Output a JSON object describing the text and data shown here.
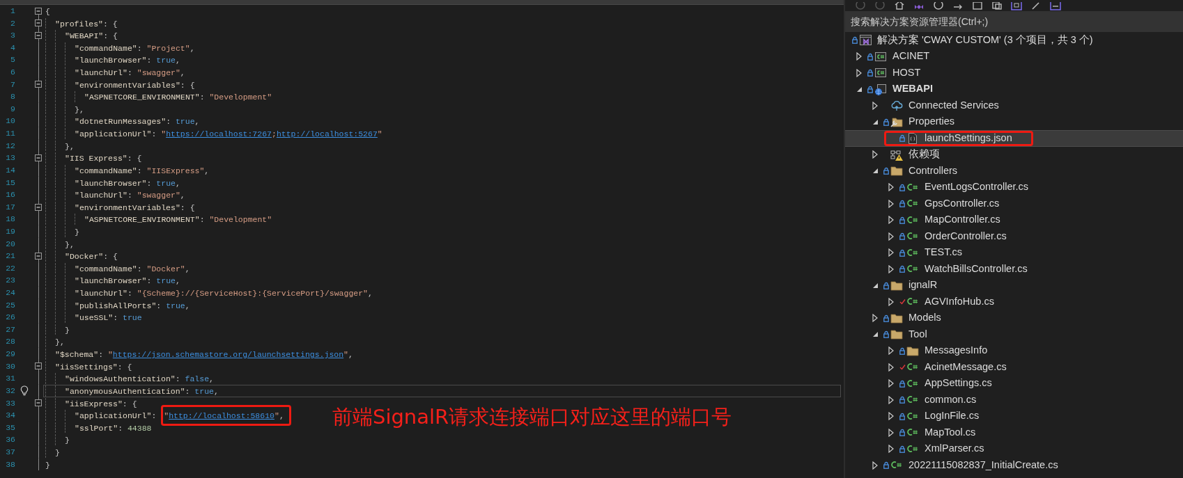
{
  "editor": {
    "lines": [
      {
        "number": "1",
        "current": false,
        "tokens": [
          {
            "kind": "punct",
            "text": "{"
          }
        ],
        "children": [
          {
            "number": "2",
            "current": false,
            "tokens": [
              {
                "kind": "key",
                "text": "\"profiles\""
              },
              {
                "kind": "punct",
                "text": ": {"
              }
            ],
            "children": [
              {
                "number": "3",
                "current": false,
                "tokens": [
                  {
                    "kind": "key",
                    "text": "\"WEBAPI\""
                  },
                  {
                    "kind": "punct",
                    "text": ": {"
                  }
                ],
                "children": [
                  {
                    "number": "4",
                    "current": false,
                    "tokens": [
                      {
                        "kind": "key",
                        "text": "\"commandName\""
                      },
                      {
                        "kind": "punct",
                        "text": ": "
                      },
                      {
                        "kind": "str",
                        "text": "\"Project\""
                      },
                      {
                        "kind": "punct",
                        "text": ","
                      }
                    ]
                  },
                  {
                    "number": "5",
                    "current": false,
                    "tokens": [
                      {
                        "kind": "key",
                        "text": "\"launchBrowser\""
                      },
                      {
                        "kind": "punct",
                        "text": ": "
                      },
                      {
                        "kind": "kw",
                        "text": "true"
                      },
                      {
                        "kind": "punct",
                        "text": ","
                      }
                    ]
                  },
                  {
                    "number": "6",
                    "current": false,
                    "tokens": [
                      {
                        "kind": "key",
                        "text": "\"launchUrl\""
                      },
                      {
                        "kind": "punct",
                        "text": ": "
                      },
                      {
                        "kind": "str",
                        "text": "\"swagger\""
                      },
                      {
                        "kind": "punct",
                        "text": ","
                      }
                    ]
                  },
                  {
                    "number": "7",
                    "current": false,
                    "tokens": [
                      {
                        "kind": "key",
                        "text": "\"environmentVariables\""
                      },
                      {
                        "kind": "punct",
                        "text": ": {"
                      }
                    ],
                    "children": [
                      {
                        "number": "8",
                        "current": false,
                        "tokens": [
                          {
                            "kind": "key",
                            "text": "\"ASPNETCORE_ENVIRONMENT\""
                          },
                          {
                            "kind": "punct",
                            "text": ": "
                          },
                          {
                            "kind": "str",
                            "text": "\"Development\""
                          }
                        ]
                      }
                    ]
                  },
                  {
                    "number": "9",
                    "current": false,
                    "tokens": [
                      {
                        "kind": "punct",
                        "text": "},"
                      }
                    ]
                  },
                  {
                    "number": "10",
                    "current": false,
                    "tokens": [
                      {
                        "kind": "key",
                        "text": "\"dotnetRunMessages\""
                      },
                      {
                        "kind": "punct",
                        "text": ": "
                      },
                      {
                        "kind": "kw",
                        "text": "true"
                      },
                      {
                        "kind": "punct",
                        "text": ","
                      }
                    ]
                  },
                  {
                    "number": "11",
                    "current": false,
                    "tokens": [
                      {
                        "kind": "key",
                        "text": "\"applicationUrl\""
                      },
                      {
                        "kind": "punct",
                        "text": ": "
                      },
                      {
                        "kind": "str",
                        "text": "\""
                      },
                      {
                        "kind": "link",
                        "text": "https://localhost:7267"
                      },
                      {
                        "kind": "str",
                        "text": ";"
                      },
                      {
                        "kind": "link",
                        "text": "http://localhost:5267"
                      },
                      {
                        "kind": "str",
                        "text": "\""
                      }
                    ]
                  }
                ]
              },
              {
                "number": "12",
                "current": false,
                "tokens": [
                  {
                    "kind": "punct",
                    "text": "},"
                  }
                ]
              },
              {
                "number": "13",
                "current": false,
                "tokens": [
                  {
                    "kind": "key",
                    "text": "\"IIS Express\""
                  },
                  {
                    "kind": "punct",
                    "text": ": {"
                  }
                ],
                "children": [
                  {
                    "number": "14",
                    "current": false,
                    "tokens": [
                      {
                        "kind": "key",
                        "text": "\"commandName\""
                      },
                      {
                        "kind": "punct",
                        "text": ": "
                      },
                      {
                        "kind": "str",
                        "text": "\"IISExpress\""
                      },
                      {
                        "kind": "punct",
                        "text": ","
                      }
                    ]
                  },
                  {
                    "number": "15",
                    "current": false,
                    "tokens": [
                      {
                        "kind": "key",
                        "text": "\"launchBrowser\""
                      },
                      {
                        "kind": "punct",
                        "text": ": "
                      },
                      {
                        "kind": "kw",
                        "text": "true"
                      },
                      {
                        "kind": "punct",
                        "text": ","
                      }
                    ]
                  },
                  {
                    "number": "16",
                    "current": false,
                    "tokens": [
                      {
                        "kind": "key",
                        "text": "\"launchUrl\""
                      },
                      {
                        "kind": "punct",
                        "text": ": "
                      },
                      {
                        "kind": "str",
                        "text": "\"swagger\""
                      },
                      {
                        "kind": "punct",
                        "text": ","
                      }
                    ]
                  },
                  {
                    "number": "17",
                    "current": false,
                    "tokens": [
                      {
                        "kind": "key",
                        "text": "\"environmentVariables\""
                      },
                      {
                        "kind": "punct",
                        "text": ": {"
                      }
                    ],
                    "children": [
                      {
                        "number": "18",
                        "current": false,
                        "tokens": [
                          {
                            "kind": "key",
                            "text": "\"ASPNETCORE_ENVIRONMENT\""
                          },
                          {
                            "kind": "punct",
                            "text": ": "
                          },
                          {
                            "kind": "str",
                            "text": "\"Development\""
                          }
                        ]
                      }
                    ]
                  },
                  {
                    "number": "19",
                    "current": false,
                    "tokens": [
                      {
                        "kind": "punct",
                        "text": "}"
                      }
                    ]
                  }
                ]
              },
              {
                "number": "20",
                "current": false,
                "tokens": [
                  {
                    "kind": "punct",
                    "text": "},"
                  }
                ]
              },
              {
                "number": "21",
                "current": false,
                "tokens": [
                  {
                    "kind": "key",
                    "text": "\"Docker\""
                  },
                  {
                    "kind": "punct",
                    "text": ": {"
                  }
                ],
                "children": [
                  {
                    "number": "22",
                    "current": false,
                    "tokens": [
                      {
                        "kind": "key",
                        "text": "\"commandName\""
                      },
                      {
                        "kind": "punct",
                        "text": ": "
                      },
                      {
                        "kind": "str",
                        "text": "\"Docker\""
                      },
                      {
                        "kind": "punct",
                        "text": ","
                      }
                    ]
                  },
                  {
                    "number": "23",
                    "current": false,
                    "tokens": [
                      {
                        "kind": "key",
                        "text": "\"launchBrowser\""
                      },
                      {
                        "kind": "punct",
                        "text": ": "
                      },
                      {
                        "kind": "kw",
                        "text": "true"
                      },
                      {
                        "kind": "punct",
                        "text": ","
                      }
                    ]
                  },
                  {
                    "number": "24",
                    "current": false,
                    "tokens": [
                      {
                        "kind": "key",
                        "text": "\"launchUrl\""
                      },
                      {
                        "kind": "punct",
                        "text": ": "
                      },
                      {
                        "kind": "str",
                        "text": "\"{Scheme}://{ServiceHost}:{ServicePort}/swagger\""
                      },
                      {
                        "kind": "punct",
                        "text": ","
                      }
                    ]
                  },
                  {
                    "number": "25",
                    "current": false,
                    "tokens": [
                      {
                        "kind": "key",
                        "text": "\"publishAllPorts\""
                      },
                      {
                        "kind": "punct",
                        "text": ": "
                      },
                      {
                        "kind": "kw",
                        "text": "true"
                      },
                      {
                        "kind": "punct",
                        "text": ","
                      }
                    ]
                  },
                  {
                    "number": "26",
                    "current": false,
                    "tokens": [
                      {
                        "kind": "key",
                        "text": "\"useSSL\""
                      },
                      {
                        "kind": "punct",
                        "text": ": "
                      },
                      {
                        "kind": "kw",
                        "text": "true"
                      }
                    ]
                  }
                ]
              },
              {
                "number": "27",
                "current": false,
                "tokens": [
                  {
                    "kind": "punct",
                    "text": "}"
                  }
                ]
              }
            ]
          },
          {
            "number": "28",
            "current": false,
            "tokens": [
              {
                "kind": "punct",
                "text": "},"
              }
            ]
          },
          {
            "number": "29",
            "current": false,
            "tokens": [
              {
                "kind": "key",
                "text": "\"$schema\""
              },
              {
                "kind": "punct",
                "text": ": "
              },
              {
                "kind": "str",
                "text": "\""
              },
              {
                "kind": "link",
                "text": "https://json.schemastore.org/launchsettings.json"
              },
              {
                "kind": "str",
                "text": "\""
              },
              {
                "kind": "punct",
                "text": ","
              }
            ]
          },
          {
            "number": "30",
            "current": false,
            "tokens": [
              {
                "kind": "key",
                "text": "\"iisSettings\""
              },
              {
                "kind": "punct",
                "text": ": {"
              }
            ],
            "children": [
              {
                "number": "31",
                "current": false,
                "tokens": [
                  {
                    "kind": "key",
                    "text": "\"windowsAuthentication\""
                  },
                  {
                    "kind": "punct",
                    "text": ": "
                  },
                  {
                    "kind": "kw",
                    "text": "false"
                  },
                  {
                    "kind": "punct",
                    "text": ","
                  }
                ]
              },
              {
                "number": "32",
                "current": true,
                "tokens": [
                  {
                    "kind": "key",
                    "text": "\"anonymousAuthentication\""
                  },
                  {
                    "kind": "punct",
                    "text": ": "
                  },
                  {
                    "kind": "kw",
                    "text": "true"
                  },
                  {
                    "kind": "punct",
                    "text": ","
                  }
                ]
              },
              {
                "number": "33",
                "current": false,
                "tokens": [
                  {
                    "kind": "key",
                    "text": "\"iisExpress\""
                  },
                  {
                    "kind": "punct",
                    "text": ": {"
                  }
                ],
                "children": [
                  {
                    "number": "34",
                    "current": false,
                    "tokens": [
                      {
                        "kind": "key",
                        "text": "\"applicationUrl\""
                      },
                      {
                        "kind": "punct",
                        "text": ": "
                      },
                      {
                        "kind": "callout",
                        "tokens": [
                          {
                            "kind": "str",
                            "text": "\""
                          },
                          {
                            "kind": "link",
                            "text": "http://localhost:58610"
                          },
                          {
                            "kind": "str",
                            "text": "\""
                          },
                          {
                            "kind": "punct",
                            "text": ","
                          }
                        ]
                      }
                    ]
                  },
                  {
                    "number": "35",
                    "current": false,
                    "tokens": [
                      {
                        "kind": "key",
                        "text": "\"sslPort\""
                      },
                      {
                        "kind": "punct",
                        "text": ": "
                      },
                      {
                        "kind": "num",
                        "text": "44388"
                      }
                    ]
                  }
                ]
              },
              {
                "number": "36",
                "current": false,
                "tokens": [
                  {
                    "kind": "punct",
                    "text": "}"
                  }
                ]
              }
            ]
          },
          {
            "number": "37",
            "current": false,
            "tokens": [
              {
                "kind": "punct",
                "text": "}"
              }
            ]
          }
        ]
      },
      {
        "number": "38",
        "current": false,
        "tokens": [
          {
            "kind": "punct",
            "text": "}"
          }
        ]
      }
    ],
    "annotation": "前端SignalR请求连接端口对应这里的端口号"
  },
  "solution_explorer": {
    "search": {
      "placeholder": "搜索解决方案资源管理器(Ctrl+;)"
    },
    "items": [
      {
        "label": "解决方案 'CWAY CUSTOM' (3 个项目，共 3 个)",
        "kind": "solution",
        "locked": true,
        "edited": false,
        "selected": false,
        "circled": false,
        "children": [
          {
            "label": "ACINET",
            "kind": "project",
            "locked": true,
            "edited": false,
            "expanded": false,
            "startup": false,
            "selected": false,
            "circled": false
          },
          {
            "label": "HOST",
            "kind": "project",
            "locked": true,
            "edited": false,
            "expanded": false,
            "startup": false,
            "selected": false,
            "circled": false
          },
          {
            "label": "WEBAPI",
            "kind": "webproject",
            "locked": true,
            "edited": false,
            "expanded": true,
            "startup": true,
            "selected": false,
            "circled": false,
            "children": [
              {
                "label": "Connected Services",
                "kind": "connected",
                "locked": false,
                "edited": false,
                "expanded": false,
                "selected": false,
                "circled": false
              },
              {
                "label": "Properties",
                "kind": "properties",
                "locked": true,
                "edited": false,
                "expanded": true,
                "selected": false,
                "circled": false,
                "children": [
                  {
                    "label": "launchSettings.json",
                    "kind": "json",
                    "locked": true,
                    "edited": false,
                    "selected": true,
                    "circled": true
                  }
                ]
              },
              {
                "label": "依赖项",
                "kind": "dependencies",
                "locked": false,
                "edited": false,
                "expanded": false,
                "selected": false,
                "circled": false
              },
              {
                "label": "Controllers",
                "kind": "folder",
                "locked": true,
                "edited": false,
                "expanded": true,
                "selected": false,
                "circled": false,
                "children": [
                  {
                    "label": "EventLogsController.cs",
                    "kind": "csharp",
                    "locked": true,
                    "edited": false,
                    "expanded": false,
                    "selected": false,
                    "circled": false
                  },
                  {
                    "label": "GpsController.cs",
                    "kind": "csharp",
                    "locked": true,
                    "edited": false,
                    "expanded": false,
                    "selected": false,
                    "circled": false
                  },
                  {
                    "label": "MapController.cs",
                    "kind": "csharp",
                    "locked": true,
                    "edited": false,
                    "expanded": false,
                    "selected": false,
                    "circled": false
                  },
                  {
                    "label": "OrderController.cs",
                    "kind": "csharp",
                    "locked": true,
                    "edited": false,
                    "expanded": false,
                    "selected": false,
                    "circled": false
                  },
                  {
                    "label": "TEST.cs",
                    "kind": "csharp",
                    "locked": true,
                    "edited": false,
                    "expanded": false,
                    "selected": false,
                    "circled": false
                  },
                  {
                    "label": "WatchBillsController.cs",
                    "kind": "csharp",
                    "locked": true,
                    "edited": false,
                    "expanded": false,
                    "selected": false,
                    "circled": false
                  }
                ]
              },
              {
                "label": "ignalR",
                "kind": "folder",
                "locked": true,
                "edited": false,
                "expanded": true,
                "selected": false,
                "circled": false,
                "children": [
                  {
                    "label": "AGVInfoHub.cs",
                    "kind": "csharp",
                    "locked": false,
                    "edited": true,
                    "expanded": false,
                    "selected": false,
                    "circled": false
                  }
                ]
              },
              {
                "label": "Models",
                "kind": "folder",
                "locked": true,
                "edited": false,
                "expanded": false,
                "selected": false,
                "circled": false
              },
              {
                "label": "Tool",
                "kind": "folder",
                "locked": true,
                "edited": false,
                "expanded": true,
                "selected": false,
                "circled": false,
                "children": [
                  {
                    "label": "MessagesInfo",
                    "kind": "folder",
                    "locked": true,
                    "edited": false,
                    "expanded": false,
                    "selected": false,
                    "circled": false
                  },
                  {
                    "label": "AcinetMessage.cs",
                    "kind": "csharp",
                    "locked": false,
                    "edited": true,
                    "expanded": false,
                    "selected": false,
                    "circled": false
                  },
                  {
                    "label": "AppSettings.cs",
                    "kind": "csharp",
                    "locked": true,
                    "edited": false,
                    "expanded": false,
                    "selected": false,
                    "circled": false
                  },
                  {
                    "label": "common.cs",
                    "kind": "csharp",
                    "locked": true,
                    "edited": false,
                    "expanded": false,
                    "selected": false,
                    "circled": false
                  },
                  {
                    "label": "LogInFile.cs",
                    "kind": "csharp",
                    "locked": true,
                    "edited": false,
                    "expanded": false,
                    "selected": false,
                    "circled": false
                  },
                  {
                    "label": "MapTool.cs",
                    "kind": "csharp",
                    "locked": true,
                    "edited": false,
                    "expanded": false,
                    "selected": false,
                    "circled": false
                  },
                  {
                    "label": "XmlParser.cs",
                    "kind": "csharp",
                    "locked": true,
                    "edited": false,
                    "expanded": false,
                    "selected": false,
                    "circled": false
                  }
                ]
              },
              {
                "label": "20221115082837_InitialCreate.cs",
                "kind": "csharp",
                "locked": true,
                "edited": false,
                "expanded": false,
                "selected": false,
                "circled": false
              }
            ]
          }
        ]
      }
    ]
  }
}
